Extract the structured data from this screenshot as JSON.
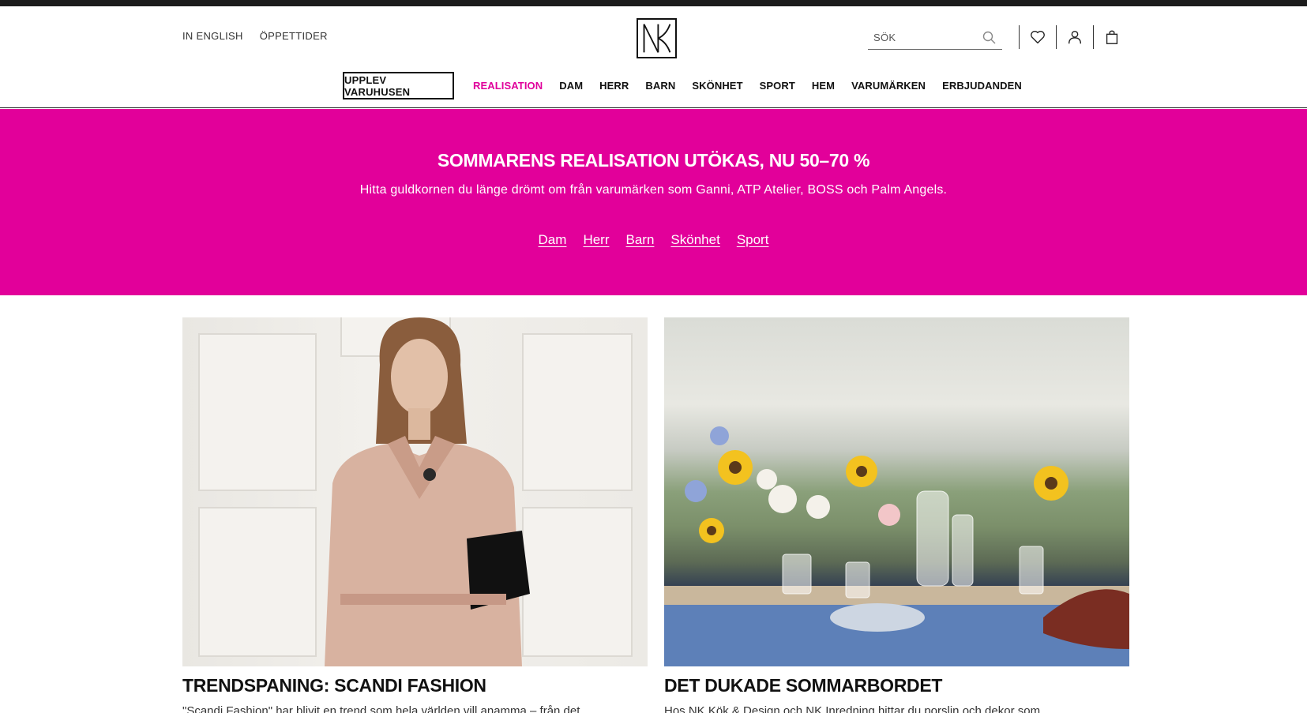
{
  "header": {
    "util_links": [
      "IN ENGLISH",
      "ÖPPETTIDER"
    ],
    "logo_text": "NK",
    "search_placeholder": "SÖK",
    "icons": [
      "search-icon",
      "heart-icon",
      "user-icon",
      "bag-icon"
    ]
  },
  "nav": {
    "upplev_label": "UPPLEV VARUHUSEN",
    "items": [
      "REALISATION",
      "DAM",
      "HERR",
      "BARN",
      "SKÖNHET",
      "SPORT",
      "HEM",
      "VARUMÄRKEN",
      "ERBJUDANDEN"
    ]
  },
  "promo": {
    "title": "SOMMARENS REALISATION UTÖKAS, NU 50–70 %",
    "text": "Hitta guldkornen du länge drömt om från varumärken som Ganni, ATP Atelier, BOSS och Palm Angels.",
    "links": [
      "Dam",
      "Herr",
      "Barn",
      "Skönhet",
      "Sport"
    ]
  },
  "cards": [
    {
      "title": "TRENDSPANING: SCANDI FASHION",
      "text": "\"Scandi Fashion\" har blivit en trend som hela världen vill anamma – från det"
    },
    {
      "title": "DET DUKADE SOMMARBORDET",
      "text": "Hos NK Kök & Design och NK Inredning hittar du porslin och dekor som"
    }
  ],
  "colors": {
    "accent": "#e2009a",
    "sale_text": "#e0009b",
    "top_strip": "#1c1c1c"
  }
}
